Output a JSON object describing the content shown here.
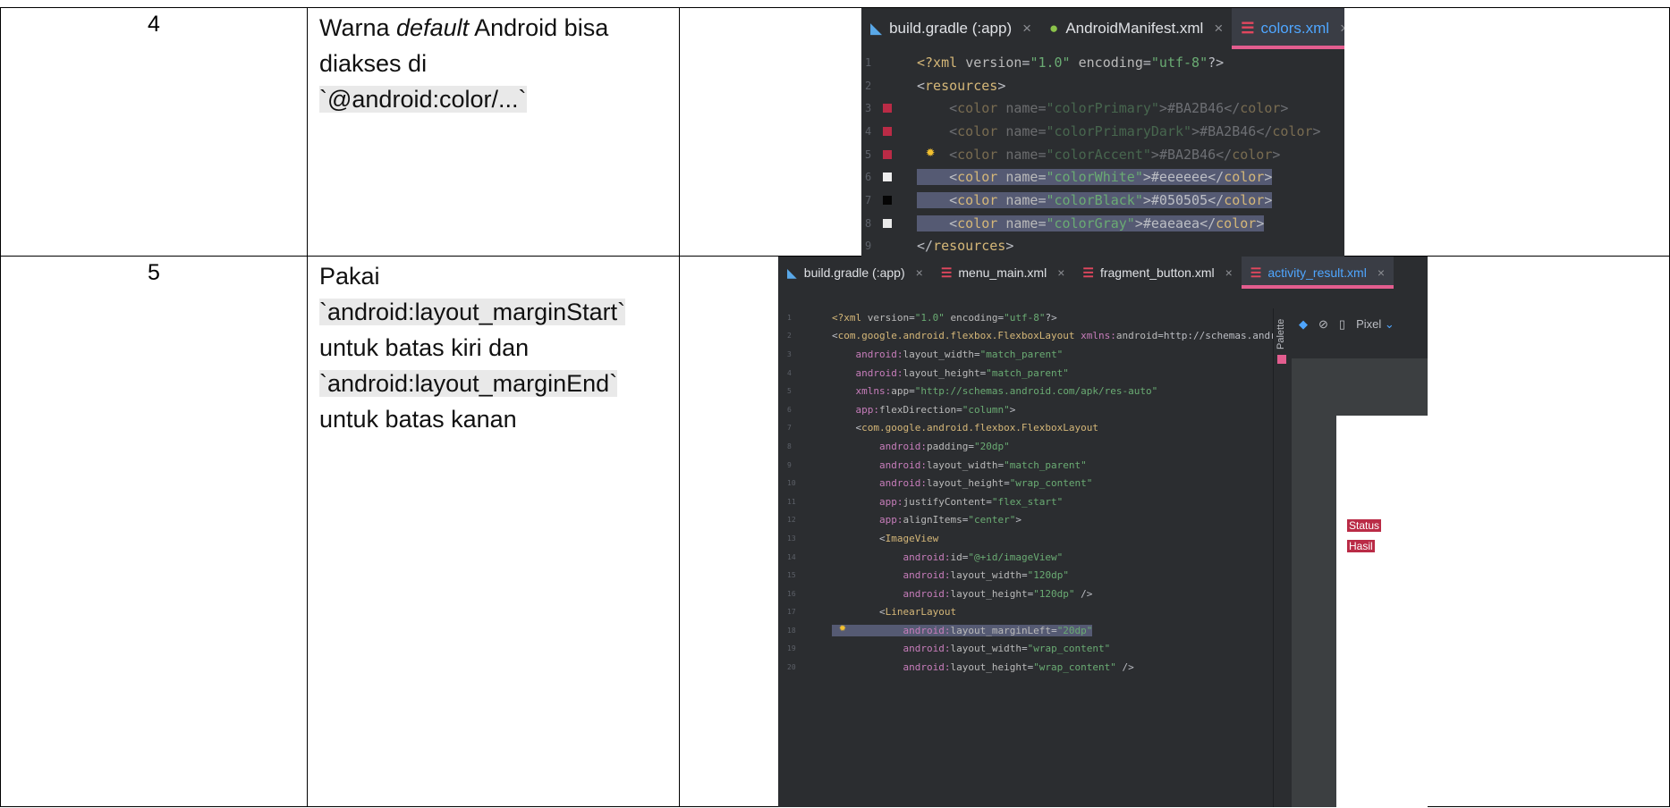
{
  "rows": [
    {
      "number": "4",
      "description": {
        "part1": "Warna ",
        "part2_italic": "default",
        "part3": " Android bisa diakses di",
        "code": "`@android:color/...`"
      }
    },
    {
      "number": "5",
      "description": {
        "line1": "Pakai",
        "code1": "`android:layout_marginStart`",
        "line2": "untuk batas kiri dan",
        "code2": "`android:layout_marginEnd`",
        "line3": "untuk batas kanan"
      }
    }
  ],
  "screenshot1": {
    "tabs": [
      {
        "label": "build.gradle (:app)",
        "icon": "gradle-icon",
        "close": "×"
      },
      {
        "label": "AndroidManifest.xml",
        "icon": "android-icon",
        "close": "×"
      },
      {
        "label": "colors.xml",
        "icon": "xml-icon",
        "close": "×",
        "active": true
      }
    ],
    "lines": [
      {
        "n": "1",
        "code": "<?xml version=\"1.0\" encoding=\"utf-8\"?>"
      },
      {
        "n": "2",
        "code": "<resources>"
      },
      {
        "n": "3",
        "code": "    <color name=\"colorPrimary\">#BA2B46</color>",
        "swatch": "#ba2b46"
      },
      {
        "n": "4",
        "code": "    <color name=\"colorPrimaryDark\">#BA2B46</color>",
        "swatch": "#ba2b46"
      },
      {
        "n": "5",
        "code": "    <color name=\"colorAccent\">#BA2B46</color>",
        "swatch": "#ba2b46"
      },
      {
        "n": "6",
        "code": "    <color name=\"colorWhite\">#eeeeee</color>",
        "swatch": "#eeeeee"
      },
      {
        "n": "7",
        "code": "    <color name=\"colorBlack\">#050505</color>",
        "swatch": "#050505"
      },
      {
        "n": "8",
        "code": "    <color name=\"colorGray\">#eaeaea</color>",
        "swatch": "#eaeaea"
      },
      {
        "n": "9",
        "code": "</resources>"
      }
    ]
  },
  "screenshot2": {
    "tabs": [
      {
        "label": "build.gradle (:app)",
        "icon": "gradle-icon",
        "close": "×"
      },
      {
        "label": "menu_main.xml",
        "icon": "xml-icon",
        "close": "×"
      },
      {
        "label": "fragment_button.xml",
        "icon": "xml-icon",
        "close": "×"
      },
      {
        "label": "activity_result.xml",
        "icon": "xml-icon",
        "close": "×",
        "active": true
      }
    ],
    "lines": [
      {
        "n": "1",
        "code": "<?xml version=\"1.0\" encoding=\"utf-8\"?>"
      },
      {
        "n": "2",
        "code": "<com.google.android.flexbox.FlexboxLayout xmlns:android=\"http://schemas.androi"
      },
      {
        "n": "3",
        "code": "    android:layout_width=\"match_parent\""
      },
      {
        "n": "4",
        "code": "    android:layout_height=\"match_parent\""
      },
      {
        "n": "5",
        "code": "    xmlns:app=\"http://schemas.android.com/apk/res-auto\""
      },
      {
        "n": "6",
        "code": "    app:flexDirection=\"column\">"
      },
      {
        "n": "7",
        "code": "    <com.google.android.flexbox.FlexboxLayout"
      },
      {
        "n": "8",
        "code": "        android:padding=\"20dp\""
      },
      {
        "n": "9",
        "code": "        android:layout_width=\"match_parent\""
      },
      {
        "n": "10",
        "code": "        android:layout_height=\"wrap_content\""
      },
      {
        "n": "11",
        "code": "        app:justifyContent=\"flex_start\""
      },
      {
        "n": "12",
        "code": "        app:alignItems=\"center\">"
      },
      {
        "n": "13",
        "code": "        <ImageView"
      },
      {
        "n": "14",
        "code": "            android:id=\"@+id/imageView\""
      },
      {
        "n": "15",
        "code": "            android:layout_width=\"120dp\""
      },
      {
        "n": "16",
        "code": "            android:layout_height=\"120dp\" />"
      },
      {
        "n": "17",
        "code": "        <LinearLayout"
      },
      {
        "n": "18",
        "code": "            android:layout_marginLeft=\"20dp\""
      },
      {
        "n": "19",
        "code": "            android:layout_width=\"wrap_content\""
      },
      {
        "n": "20",
        "code": "            android:layout_height=\"wrap_content\" />"
      }
    ],
    "side_panel_label": "Palette",
    "toolbar_device": "Pixel",
    "preview_labels": [
      "Status",
      "Hasil"
    ]
  },
  "colors": {
    "ide_bg": "#2b2d30",
    "selection": "#555a73",
    "accent_tab": "#e35d8f",
    "preview_badge": "#ba2b46"
  }
}
